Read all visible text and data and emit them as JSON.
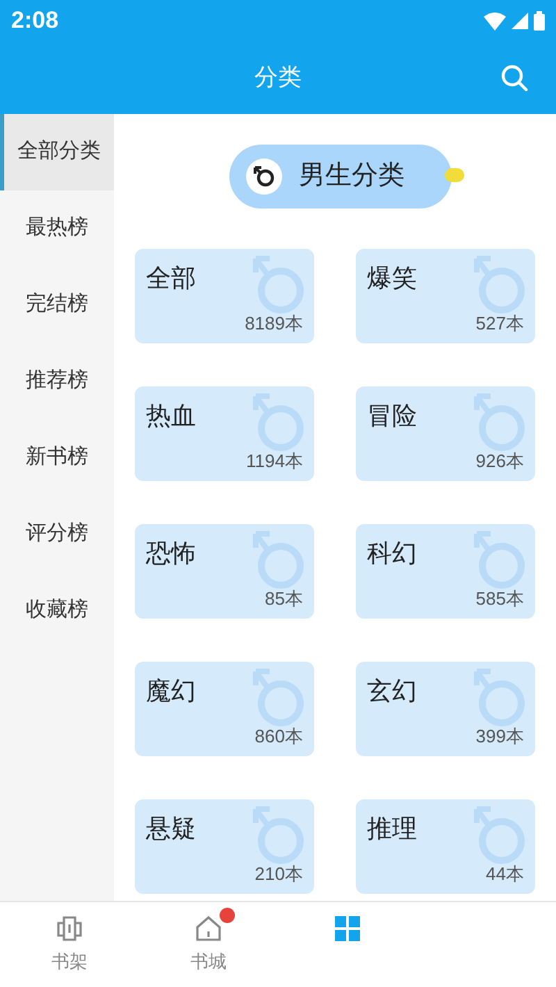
{
  "status_bar": {
    "time": "2:08"
  },
  "header": {
    "title": "分类"
  },
  "sidebar": {
    "items": [
      {
        "label": "全部分类",
        "selected": true
      },
      {
        "label": "最热榜",
        "selected": false
      },
      {
        "label": "完结榜",
        "selected": false
      },
      {
        "label": "推荐榜",
        "selected": false
      },
      {
        "label": "新书榜",
        "selected": false
      },
      {
        "label": "评分榜",
        "selected": false
      },
      {
        "label": "收藏榜",
        "selected": false
      }
    ]
  },
  "section": {
    "title": "男生分类"
  },
  "categories": [
    {
      "name": "全部",
      "count": "8189本"
    },
    {
      "name": "爆笑",
      "count": "527本"
    },
    {
      "name": "热血",
      "count": "1194本"
    },
    {
      "name": "冒险",
      "count": "926本"
    },
    {
      "name": "恐怖",
      "count": "85本"
    },
    {
      "name": "科幻",
      "count": "585本"
    },
    {
      "name": "魔幻",
      "count": "860本"
    },
    {
      "name": "玄幻",
      "count": "399本"
    },
    {
      "name": "悬疑",
      "count": "210本"
    },
    {
      "name": "推理",
      "count": "44本"
    }
  ],
  "bottom_nav": [
    {
      "kind": "shelf",
      "label": "书架",
      "selected": false,
      "badge": false
    },
    {
      "kind": "store",
      "label": "书城",
      "selected": false,
      "badge": true
    },
    {
      "kind": "category",
      "selected": true,
      "badge": false
    }
  ]
}
